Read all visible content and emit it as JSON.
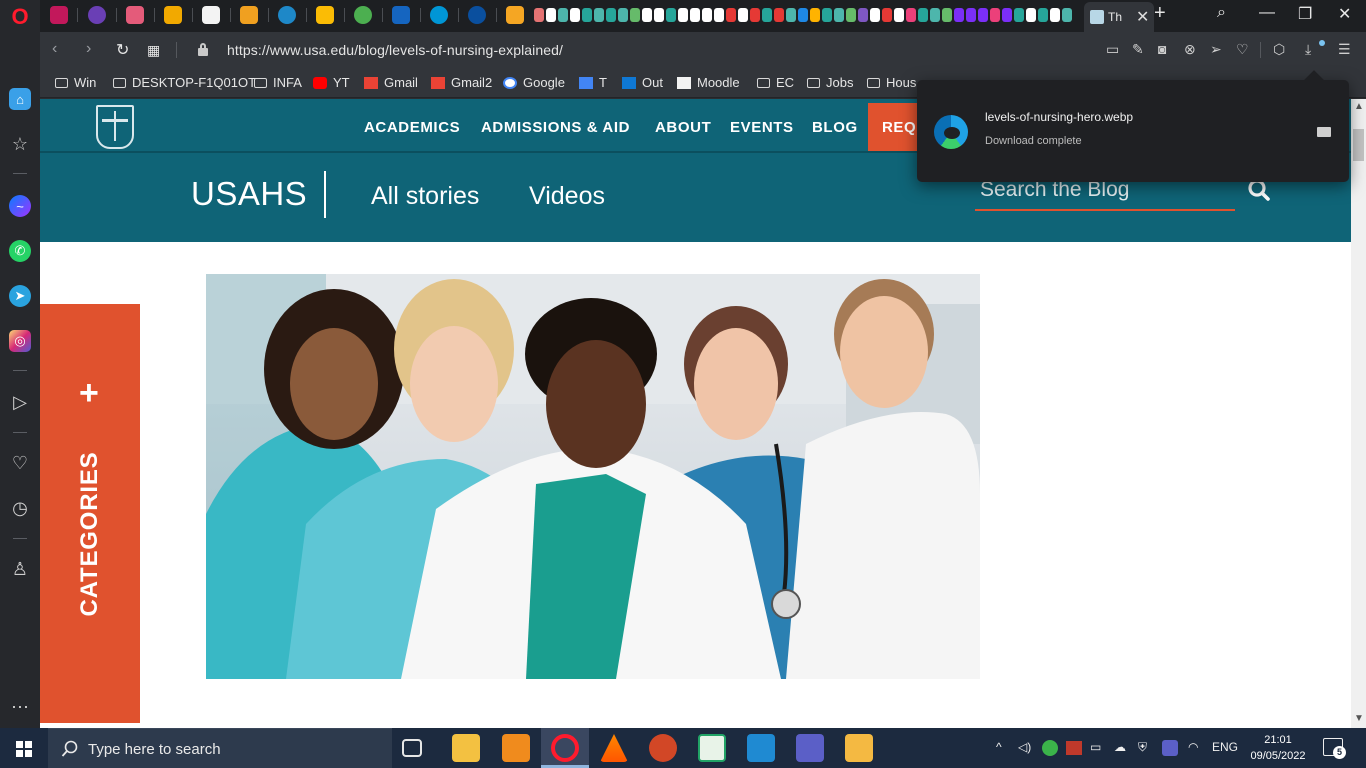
{
  "browser": {
    "active_tab_title": "Th",
    "url": "https://www.usa.edu/blog/levels-of-nursing-explained/",
    "bookmarks": [
      "Win",
      "DESKTOP-F1Q01OT",
      "INFA",
      "YT",
      "Gmail",
      "Gmail2",
      "Google",
      "T",
      "Out",
      "Moodle",
      "EC",
      "Jobs",
      "Hous"
    ]
  },
  "download": {
    "filename": "levels-of-nursing-hero.webp",
    "status": "Download complete"
  },
  "site": {
    "nav": [
      "ACADEMICS",
      "ADMISSIONS & AID",
      "ABOUT",
      "EVENTS",
      "BLOG"
    ],
    "request_label": "REQ",
    "brand": "USAHS",
    "sub_nav": [
      "All stories",
      "Videos"
    ],
    "search_placeholder": "Search the Blog",
    "categories_label": "CATEGORIES"
  },
  "taskbar": {
    "search_placeholder": "Type here to search",
    "language": "ENG",
    "time": "21:01",
    "date": "09/05/2022",
    "notifications": "5"
  },
  "colors": {
    "site_teal": "#0f6477",
    "site_accent": "#e0522e",
    "browser_dark": "#32353a"
  }
}
